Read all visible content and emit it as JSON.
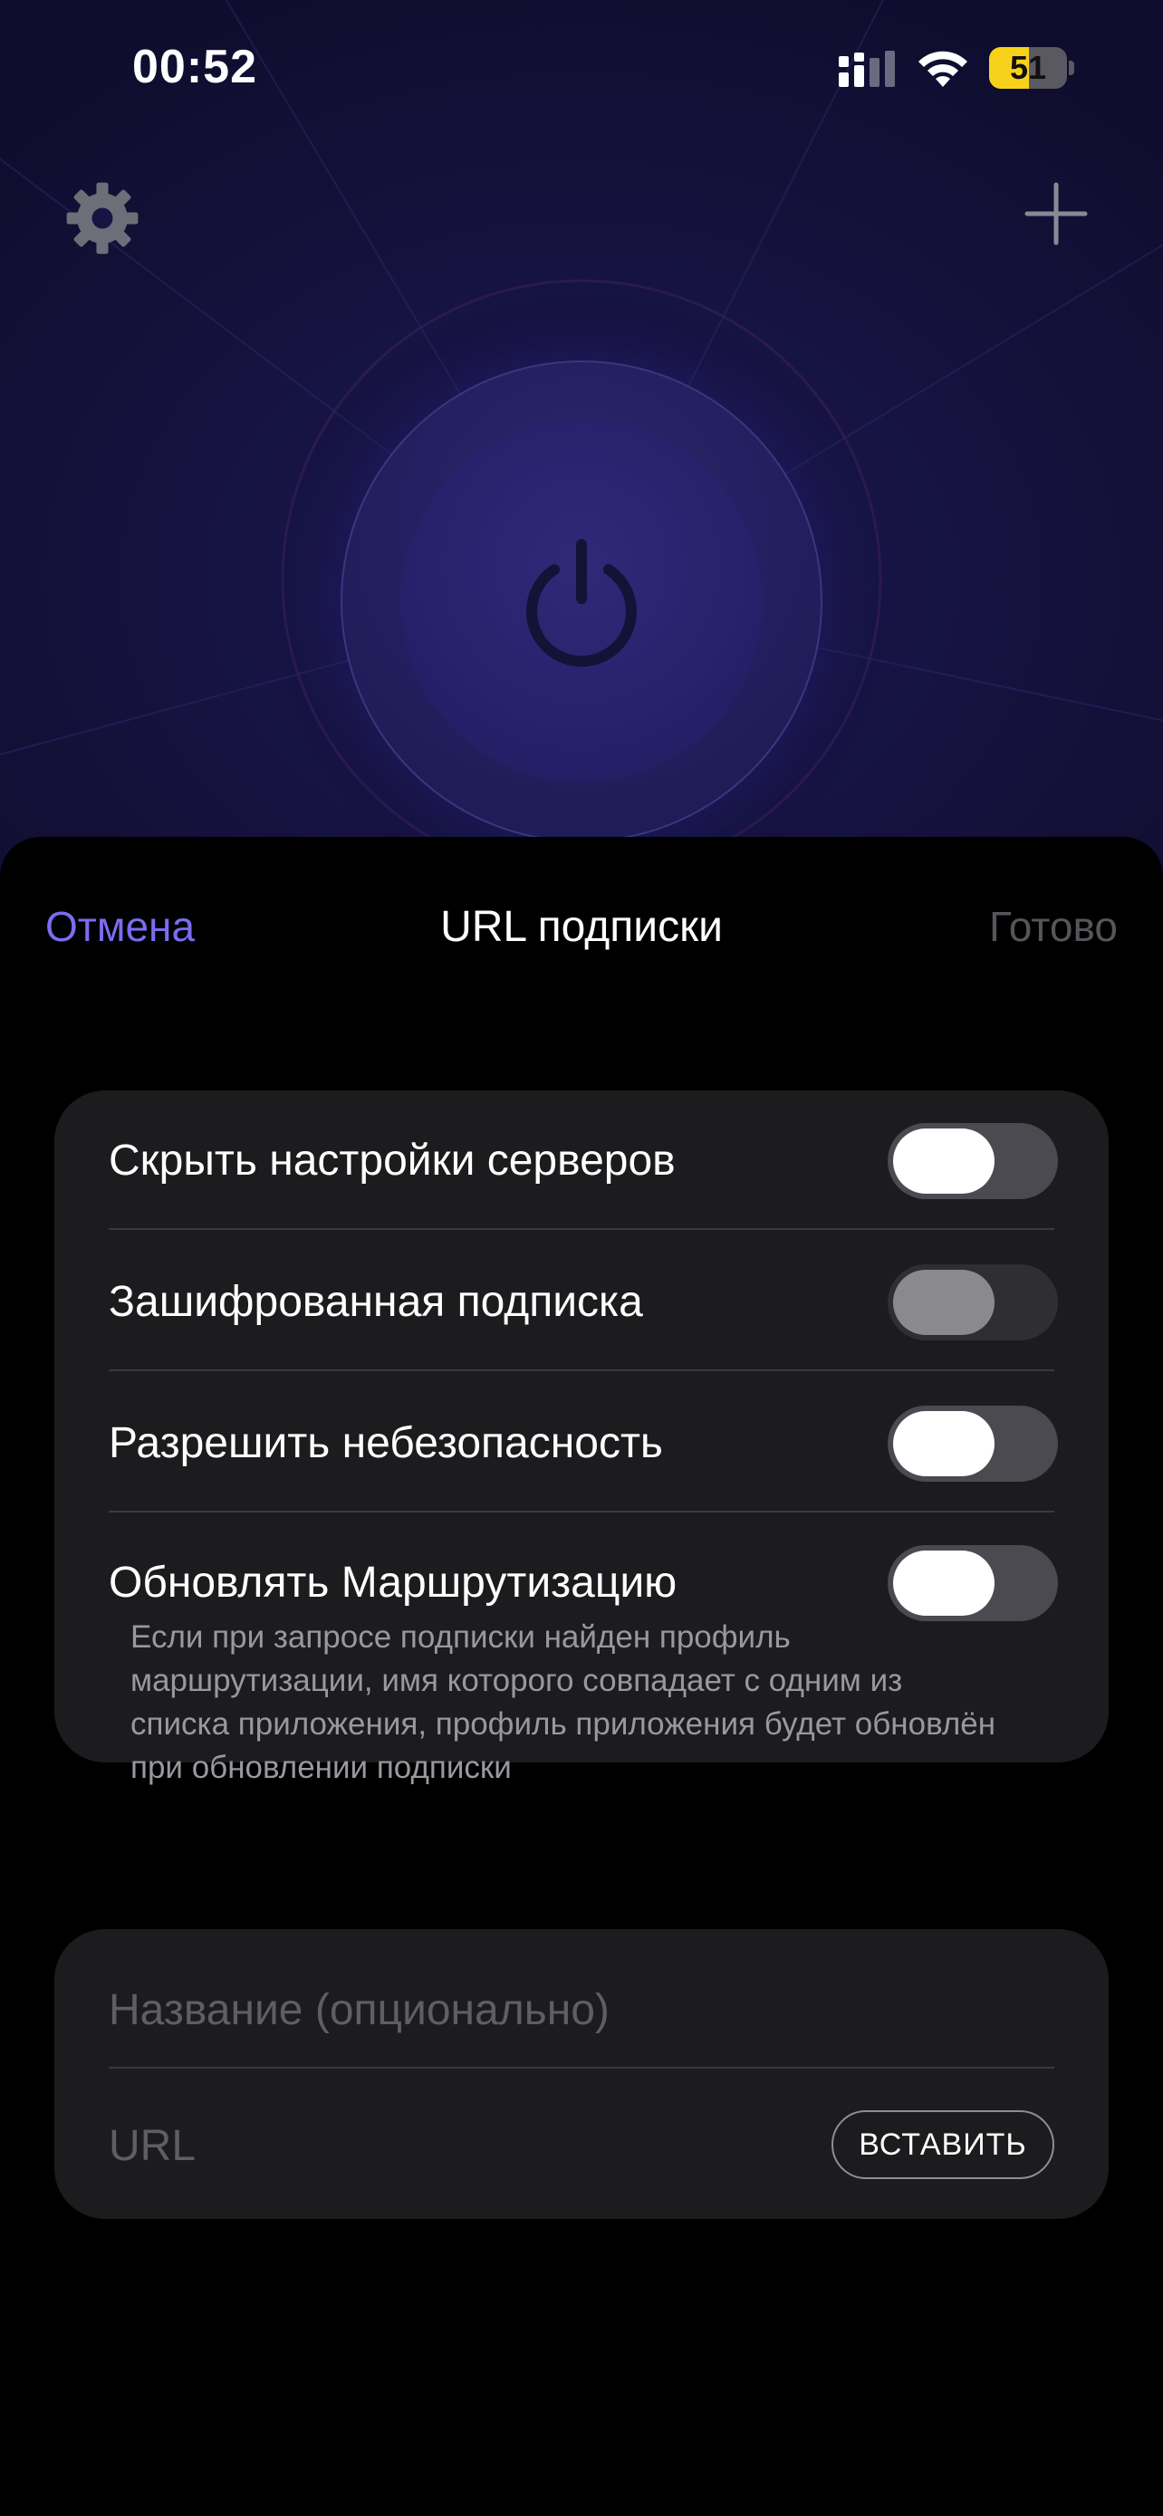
{
  "status_bar": {
    "time": "00:52",
    "battery_level": "51",
    "battery_fraction": 0.51,
    "signal_icon": "cellular-signal-icon",
    "wifi_icon": "wifi-icon"
  },
  "app_background": {
    "settings_icon": "gear-icon",
    "add_icon": "plus-icon",
    "power_icon": "power-icon"
  },
  "sheet": {
    "cancel_label": "Отмена",
    "title": "URL подписки",
    "done_label": "Готово"
  },
  "settings": {
    "items": [
      {
        "label": "Скрыть настройки серверов",
        "enabled": true,
        "on": false
      },
      {
        "label": "Зашифрованная подписка",
        "enabled": false,
        "on": false
      },
      {
        "label": "Разрешить небезопасность",
        "enabled": true,
        "on": false
      },
      {
        "label": "Обновлять Маршрутизацию",
        "enabled": true,
        "on": false
      }
    ],
    "routing_description": "Если при запросе подписки найден профиль маршрутизации, имя которого совпадает с одним из списка приложения, профиль приложения будет обновлён при обновлении подписки"
  },
  "form": {
    "name_placeholder": "Название (опционально)",
    "name_value": "",
    "url_placeholder": "URL",
    "url_value": "",
    "paste_label": "ВСТАВИТЬ"
  },
  "colors": {
    "accent": "#7b6cf0",
    "card_background": "#1c1c1e",
    "battery_fill": "#f7d21a"
  }
}
